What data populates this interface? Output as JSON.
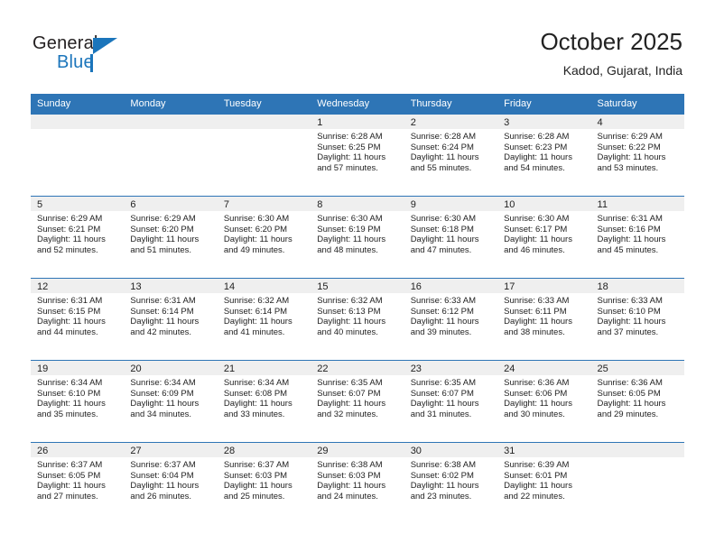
{
  "brand": {
    "name_top": "General",
    "name_bottom": "Blue",
    "accent_color": "#1b75bb"
  },
  "header": {
    "title": "October 2025",
    "subtitle": "Kadod, Gujarat, India"
  },
  "calendar": {
    "header_bg": "#2e75b6",
    "daynum_bg": "#efefef",
    "weekdays": [
      "Sunday",
      "Monday",
      "Tuesday",
      "Wednesday",
      "Thursday",
      "Friday",
      "Saturday"
    ],
    "weeks": [
      [
        {
          "day": "",
          "empty": true
        },
        {
          "day": "",
          "empty": true
        },
        {
          "day": "",
          "empty": true
        },
        {
          "day": "1",
          "sunrise": "Sunrise: 6:28 AM",
          "sunset": "Sunset: 6:25 PM",
          "daylight1": "Daylight: 11 hours",
          "daylight2": "and 57 minutes."
        },
        {
          "day": "2",
          "sunrise": "Sunrise: 6:28 AM",
          "sunset": "Sunset: 6:24 PM",
          "daylight1": "Daylight: 11 hours",
          "daylight2": "and 55 minutes."
        },
        {
          "day": "3",
          "sunrise": "Sunrise: 6:28 AM",
          "sunset": "Sunset: 6:23 PM",
          "daylight1": "Daylight: 11 hours",
          "daylight2": "and 54 minutes."
        },
        {
          "day": "4",
          "sunrise": "Sunrise: 6:29 AM",
          "sunset": "Sunset: 6:22 PM",
          "daylight1": "Daylight: 11 hours",
          "daylight2": "and 53 minutes."
        }
      ],
      [
        {
          "day": "5",
          "sunrise": "Sunrise: 6:29 AM",
          "sunset": "Sunset: 6:21 PM",
          "daylight1": "Daylight: 11 hours",
          "daylight2": "and 52 minutes."
        },
        {
          "day": "6",
          "sunrise": "Sunrise: 6:29 AM",
          "sunset": "Sunset: 6:20 PM",
          "daylight1": "Daylight: 11 hours",
          "daylight2": "and 51 minutes."
        },
        {
          "day": "7",
          "sunrise": "Sunrise: 6:30 AM",
          "sunset": "Sunset: 6:20 PM",
          "daylight1": "Daylight: 11 hours",
          "daylight2": "and 49 minutes."
        },
        {
          "day": "8",
          "sunrise": "Sunrise: 6:30 AM",
          "sunset": "Sunset: 6:19 PM",
          "daylight1": "Daylight: 11 hours",
          "daylight2": "and 48 minutes."
        },
        {
          "day": "9",
          "sunrise": "Sunrise: 6:30 AM",
          "sunset": "Sunset: 6:18 PM",
          "daylight1": "Daylight: 11 hours",
          "daylight2": "and 47 minutes."
        },
        {
          "day": "10",
          "sunrise": "Sunrise: 6:30 AM",
          "sunset": "Sunset: 6:17 PM",
          "daylight1": "Daylight: 11 hours",
          "daylight2": "and 46 minutes."
        },
        {
          "day": "11",
          "sunrise": "Sunrise: 6:31 AM",
          "sunset": "Sunset: 6:16 PM",
          "daylight1": "Daylight: 11 hours",
          "daylight2": "and 45 minutes."
        }
      ],
      [
        {
          "day": "12",
          "sunrise": "Sunrise: 6:31 AM",
          "sunset": "Sunset: 6:15 PM",
          "daylight1": "Daylight: 11 hours",
          "daylight2": "and 44 minutes."
        },
        {
          "day": "13",
          "sunrise": "Sunrise: 6:31 AM",
          "sunset": "Sunset: 6:14 PM",
          "daylight1": "Daylight: 11 hours",
          "daylight2": "and 42 minutes."
        },
        {
          "day": "14",
          "sunrise": "Sunrise: 6:32 AM",
          "sunset": "Sunset: 6:14 PM",
          "daylight1": "Daylight: 11 hours",
          "daylight2": "and 41 minutes."
        },
        {
          "day": "15",
          "sunrise": "Sunrise: 6:32 AM",
          "sunset": "Sunset: 6:13 PM",
          "daylight1": "Daylight: 11 hours",
          "daylight2": "and 40 minutes."
        },
        {
          "day": "16",
          "sunrise": "Sunrise: 6:33 AM",
          "sunset": "Sunset: 6:12 PM",
          "daylight1": "Daylight: 11 hours",
          "daylight2": "and 39 minutes."
        },
        {
          "day": "17",
          "sunrise": "Sunrise: 6:33 AM",
          "sunset": "Sunset: 6:11 PM",
          "daylight1": "Daylight: 11 hours",
          "daylight2": "and 38 minutes."
        },
        {
          "day": "18",
          "sunrise": "Sunrise: 6:33 AM",
          "sunset": "Sunset: 6:10 PM",
          "daylight1": "Daylight: 11 hours",
          "daylight2": "and 37 minutes."
        }
      ],
      [
        {
          "day": "19",
          "sunrise": "Sunrise: 6:34 AM",
          "sunset": "Sunset: 6:10 PM",
          "daylight1": "Daylight: 11 hours",
          "daylight2": "and 35 minutes."
        },
        {
          "day": "20",
          "sunrise": "Sunrise: 6:34 AM",
          "sunset": "Sunset: 6:09 PM",
          "daylight1": "Daylight: 11 hours",
          "daylight2": "and 34 minutes."
        },
        {
          "day": "21",
          "sunrise": "Sunrise: 6:34 AM",
          "sunset": "Sunset: 6:08 PM",
          "daylight1": "Daylight: 11 hours",
          "daylight2": "and 33 minutes."
        },
        {
          "day": "22",
          "sunrise": "Sunrise: 6:35 AM",
          "sunset": "Sunset: 6:07 PM",
          "daylight1": "Daylight: 11 hours",
          "daylight2": "and 32 minutes."
        },
        {
          "day": "23",
          "sunrise": "Sunrise: 6:35 AM",
          "sunset": "Sunset: 6:07 PM",
          "daylight1": "Daylight: 11 hours",
          "daylight2": "and 31 minutes."
        },
        {
          "day": "24",
          "sunrise": "Sunrise: 6:36 AM",
          "sunset": "Sunset: 6:06 PM",
          "daylight1": "Daylight: 11 hours",
          "daylight2": "and 30 minutes."
        },
        {
          "day": "25",
          "sunrise": "Sunrise: 6:36 AM",
          "sunset": "Sunset: 6:05 PM",
          "daylight1": "Daylight: 11 hours",
          "daylight2": "and 29 minutes."
        }
      ],
      [
        {
          "day": "26",
          "sunrise": "Sunrise: 6:37 AM",
          "sunset": "Sunset: 6:05 PM",
          "daylight1": "Daylight: 11 hours",
          "daylight2": "and 27 minutes."
        },
        {
          "day": "27",
          "sunrise": "Sunrise: 6:37 AM",
          "sunset": "Sunset: 6:04 PM",
          "daylight1": "Daylight: 11 hours",
          "daylight2": "and 26 minutes."
        },
        {
          "day": "28",
          "sunrise": "Sunrise: 6:37 AM",
          "sunset": "Sunset: 6:03 PM",
          "daylight1": "Daylight: 11 hours",
          "daylight2": "and 25 minutes."
        },
        {
          "day": "29",
          "sunrise": "Sunrise: 6:38 AM",
          "sunset": "Sunset: 6:03 PM",
          "daylight1": "Daylight: 11 hours",
          "daylight2": "and 24 minutes."
        },
        {
          "day": "30",
          "sunrise": "Sunrise: 6:38 AM",
          "sunset": "Sunset: 6:02 PM",
          "daylight1": "Daylight: 11 hours",
          "daylight2": "and 23 minutes."
        },
        {
          "day": "31",
          "sunrise": "Sunrise: 6:39 AM",
          "sunset": "Sunset: 6:01 PM",
          "daylight1": "Daylight: 11 hours",
          "daylight2": "and 22 minutes."
        },
        {
          "day": "",
          "empty": true
        }
      ]
    ]
  }
}
